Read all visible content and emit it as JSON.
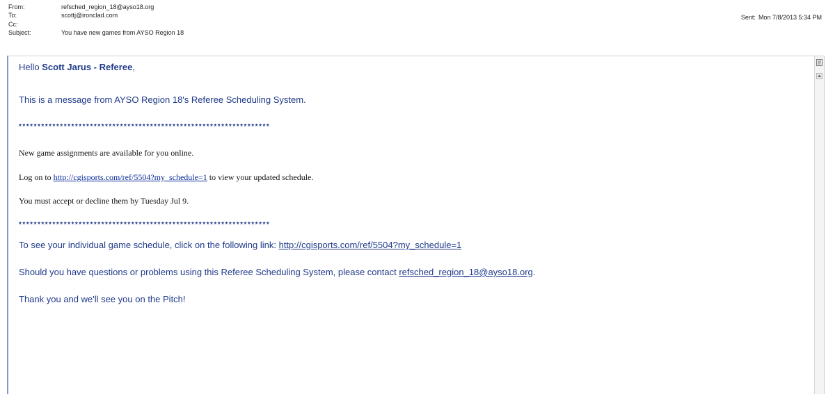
{
  "header": {
    "from_label": "From:",
    "from_value": "refsched_region_18@ayso18.org",
    "to_label": "To:",
    "to_value": "scottj@ironclad.com",
    "cc_label": "Cc:",
    "cc_value": "",
    "subject_label": "Subject:",
    "subject_value": "You have new games from AYSO Region 18",
    "sent_label": "Sent:",
    "sent_value": "Mon 7/8/2013 5:34 PM"
  },
  "message": {
    "greeting_prefix": "Hello ",
    "greeting_name": "Scott Jarus - Referee",
    "greeting_suffix": ",",
    "intro": "This is a message from AYSO Region 18's Referee Scheduling System.",
    "stars": "*******************************************************************",
    "line_available": "New game assignments are available for you online.",
    "logon_prefix": "Log on to ",
    "logon_link": "http://cgisports.com/ref/5504?my_schedule=1",
    "logon_suffix": " to view your updated schedule.",
    "accept_line": "You must accept or decline them by Tuesday Jul 9.",
    "schedule_prefix": "To see your individual game schedule, click on the following link: ",
    "schedule_link": "http://cgisports.com/ref/5504?my_schedule=1",
    "questions_prefix": "Should you have questions or problems using this Referee Scheduling System, please contact ",
    "questions_email": "refsched_region_18@ayso18.org",
    "questions_suffix": ".",
    "closing": "Thank you and we'll see you on the Pitch!"
  },
  "icons": {
    "scroll_icon": "reading-pane-icon",
    "scroll_up": "scroll-up-arrow-icon"
  }
}
